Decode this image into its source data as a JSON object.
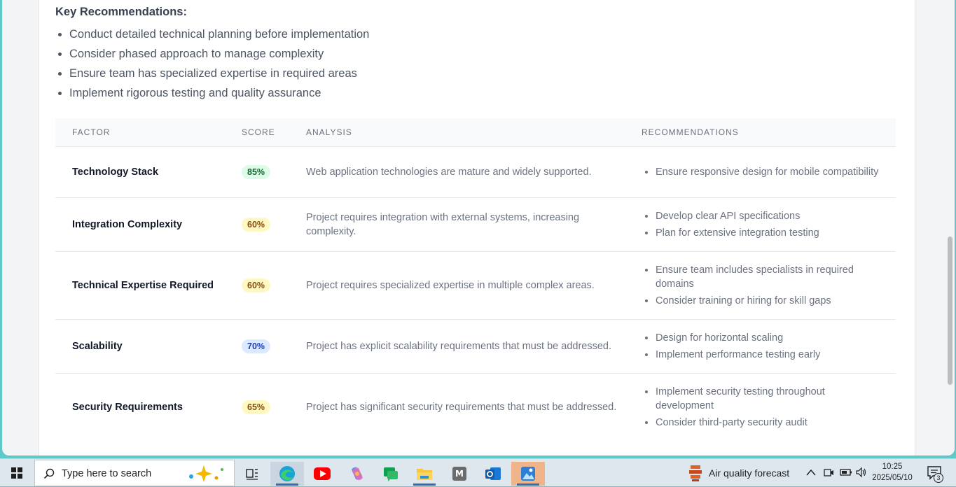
{
  "key_recommendations": {
    "title": "Key Recommendations:",
    "items": [
      "Conduct detailed technical planning before implementation",
      "Consider phased approach to manage complexity",
      "Ensure team has specialized expertise in required areas",
      "Implement rigorous testing and quality assurance"
    ]
  },
  "table": {
    "headers": {
      "factor": "FACTOR",
      "score": "SCORE",
      "analysis": "ANALYSIS",
      "recommendations": "RECOMMENDATIONS"
    },
    "rows": [
      {
        "factor": "Technology Stack",
        "score": "85%",
        "score_color": "#166534",
        "score_bg": "#dcfce7",
        "analysis": "Web application technologies are mature and widely supported.",
        "recommendations": [
          "Ensure responsive design for mobile compatibility"
        ]
      },
      {
        "factor": "Integration Complexity",
        "score": "60%",
        "score_color": "#854d0e",
        "score_bg": "#fef9c3",
        "analysis": "Project requires integration with external systems, increasing complexity.",
        "recommendations": [
          "Develop clear API specifications",
          "Plan for extensive integration testing"
        ]
      },
      {
        "factor": "Technical Expertise Required",
        "score": "60%",
        "score_color": "#854d0e",
        "score_bg": "#fef9c3",
        "analysis": "Project requires specialized expertise in multiple complex areas.",
        "recommendations": [
          "Ensure team includes specialists in required domains",
          "Consider training or hiring for skill gaps"
        ]
      },
      {
        "factor": "Scalability",
        "score": "70%",
        "score_color": "#1e40af",
        "score_bg": "#dbeafe",
        "analysis": "Project has explicit scalability requirements that must be addressed.",
        "recommendations": [
          "Design for horizontal scaling",
          "Implement performance testing early"
        ]
      },
      {
        "factor": "Security Requirements",
        "score": "65%",
        "score_color": "#854d0e",
        "score_bg": "#fef9c3",
        "analysis": "Project has significant security requirements that must be addressed.",
        "recommendations": [
          "Implement security testing throughout development",
          "Consider third-party security audit"
        ]
      }
    ]
  },
  "taskbar": {
    "search_placeholder": "Type here to search",
    "weather": "Air quality forecast",
    "time": "10:25",
    "date": "2025/05/10",
    "notification_count": "3",
    "apps": [
      "task-view",
      "edge",
      "youtube",
      "copilot",
      "chat",
      "file-explorer",
      "app-m",
      "outlook",
      "photos"
    ]
  }
}
